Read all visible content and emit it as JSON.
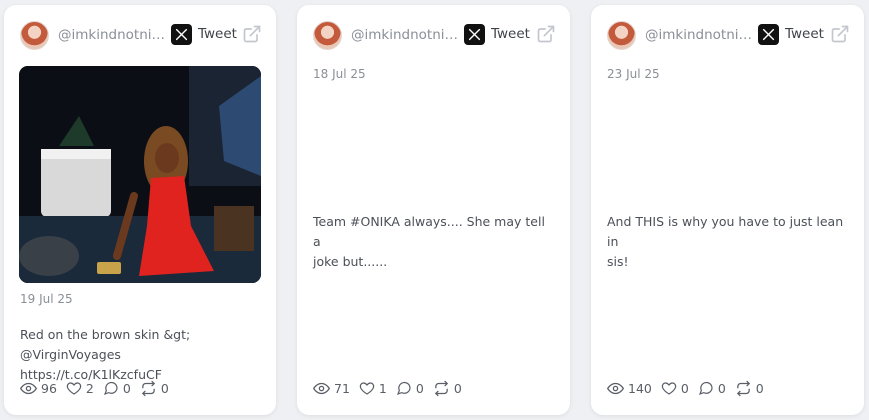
{
  "cards": [
    {
      "handle": "@imkindnotnic...",
      "tweet_label": "Tweet",
      "date": "19 Jul 25",
      "text_line1": "Red on the brown skin &gt;",
      "text_line2": "@VirginVoyages https://t.co/K1lKzcfuCF",
      "views": "96",
      "likes": "2",
      "replies": "0",
      "retweets": "0"
    },
    {
      "handle": "@imkindnotnic...",
      "tweet_label": "Tweet",
      "date": "18 Jul 25",
      "text_line1": "Team #ONIKA always.... She may tell a",
      "text_line2": "joke but......",
      "views": "71",
      "likes": "1",
      "replies": "0",
      "retweets": "0"
    },
    {
      "handle": "@imkindnotnic...",
      "tweet_label": "Tweet",
      "date": "23 Jul 25",
      "text_line1": "And THIS is why you have to just lean in",
      "text_line2": "sis!",
      "views": "140",
      "likes": "0",
      "replies": "0",
      "retweets": "0"
    }
  ],
  "icons": {
    "x_logo": "x-logo-icon",
    "external_link": "external-link-icon",
    "views": "eye-icon",
    "likes": "heart-icon",
    "replies": "comment-icon",
    "retweets": "retweet-icon"
  },
  "colors": {
    "background": "#eef0f3",
    "card": "#ffffff",
    "muted_text": "#8a8f98",
    "dress_red": "#e0231f"
  }
}
